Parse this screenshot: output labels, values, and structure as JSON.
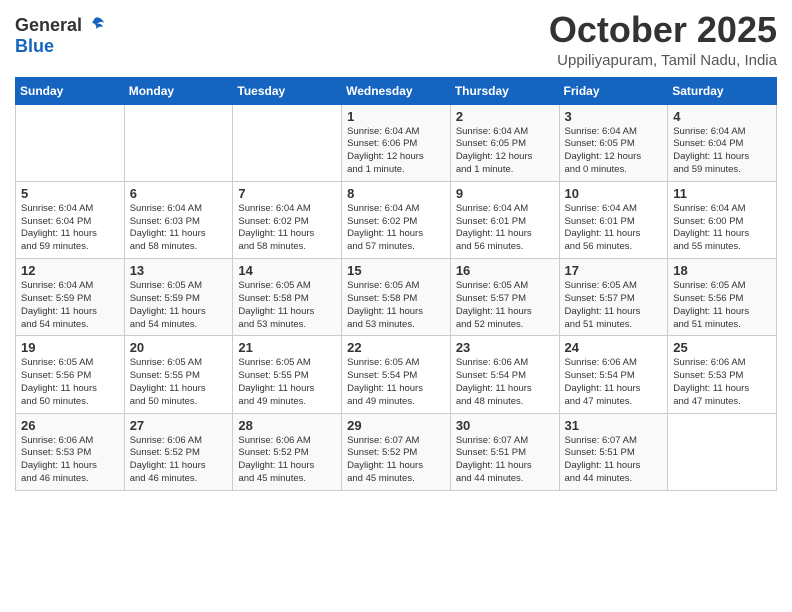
{
  "header": {
    "logo_general": "General",
    "logo_blue": "Blue",
    "month": "October 2025",
    "location": "Uppiliyapuram, Tamil Nadu, India"
  },
  "weekdays": [
    "Sunday",
    "Monday",
    "Tuesday",
    "Wednesday",
    "Thursday",
    "Friday",
    "Saturday"
  ],
  "weeks": [
    [
      {
        "day": "",
        "info": ""
      },
      {
        "day": "",
        "info": ""
      },
      {
        "day": "",
        "info": ""
      },
      {
        "day": "1",
        "info": "Sunrise: 6:04 AM\nSunset: 6:06 PM\nDaylight: 12 hours\nand 1 minute."
      },
      {
        "day": "2",
        "info": "Sunrise: 6:04 AM\nSunset: 6:05 PM\nDaylight: 12 hours\nand 1 minute."
      },
      {
        "day": "3",
        "info": "Sunrise: 6:04 AM\nSunset: 6:05 PM\nDaylight: 12 hours\nand 0 minutes."
      },
      {
        "day": "4",
        "info": "Sunrise: 6:04 AM\nSunset: 6:04 PM\nDaylight: 11 hours\nand 59 minutes."
      }
    ],
    [
      {
        "day": "5",
        "info": "Sunrise: 6:04 AM\nSunset: 6:04 PM\nDaylight: 11 hours\nand 59 minutes."
      },
      {
        "day": "6",
        "info": "Sunrise: 6:04 AM\nSunset: 6:03 PM\nDaylight: 11 hours\nand 58 minutes."
      },
      {
        "day": "7",
        "info": "Sunrise: 6:04 AM\nSunset: 6:02 PM\nDaylight: 11 hours\nand 58 minutes."
      },
      {
        "day": "8",
        "info": "Sunrise: 6:04 AM\nSunset: 6:02 PM\nDaylight: 11 hours\nand 57 minutes."
      },
      {
        "day": "9",
        "info": "Sunrise: 6:04 AM\nSunset: 6:01 PM\nDaylight: 11 hours\nand 56 minutes."
      },
      {
        "day": "10",
        "info": "Sunrise: 6:04 AM\nSunset: 6:01 PM\nDaylight: 11 hours\nand 56 minutes."
      },
      {
        "day": "11",
        "info": "Sunrise: 6:04 AM\nSunset: 6:00 PM\nDaylight: 11 hours\nand 55 minutes."
      }
    ],
    [
      {
        "day": "12",
        "info": "Sunrise: 6:04 AM\nSunset: 5:59 PM\nDaylight: 11 hours\nand 54 minutes."
      },
      {
        "day": "13",
        "info": "Sunrise: 6:05 AM\nSunset: 5:59 PM\nDaylight: 11 hours\nand 54 minutes."
      },
      {
        "day": "14",
        "info": "Sunrise: 6:05 AM\nSunset: 5:58 PM\nDaylight: 11 hours\nand 53 minutes."
      },
      {
        "day": "15",
        "info": "Sunrise: 6:05 AM\nSunset: 5:58 PM\nDaylight: 11 hours\nand 53 minutes."
      },
      {
        "day": "16",
        "info": "Sunrise: 6:05 AM\nSunset: 5:57 PM\nDaylight: 11 hours\nand 52 minutes."
      },
      {
        "day": "17",
        "info": "Sunrise: 6:05 AM\nSunset: 5:57 PM\nDaylight: 11 hours\nand 51 minutes."
      },
      {
        "day": "18",
        "info": "Sunrise: 6:05 AM\nSunset: 5:56 PM\nDaylight: 11 hours\nand 51 minutes."
      }
    ],
    [
      {
        "day": "19",
        "info": "Sunrise: 6:05 AM\nSunset: 5:56 PM\nDaylight: 11 hours\nand 50 minutes."
      },
      {
        "day": "20",
        "info": "Sunrise: 6:05 AM\nSunset: 5:55 PM\nDaylight: 11 hours\nand 50 minutes."
      },
      {
        "day": "21",
        "info": "Sunrise: 6:05 AM\nSunset: 5:55 PM\nDaylight: 11 hours\nand 49 minutes."
      },
      {
        "day": "22",
        "info": "Sunrise: 6:05 AM\nSunset: 5:54 PM\nDaylight: 11 hours\nand 49 minutes."
      },
      {
        "day": "23",
        "info": "Sunrise: 6:06 AM\nSunset: 5:54 PM\nDaylight: 11 hours\nand 48 minutes."
      },
      {
        "day": "24",
        "info": "Sunrise: 6:06 AM\nSunset: 5:54 PM\nDaylight: 11 hours\nand 47 minutes."
      },
      {
        "day": "25",
        "info": "Sunrise: 6:06 AM\nSunset: 5:53 PM\nDaylight: 11 hours\nand 47 minutes."
      }
    ],
    [
      {
        "day": "26",
        "info": "Sunrise: 6:06 AM\nSunset: 5:53 PM\nDaylight: 11 hours\nand 46 minutes."
      },
      {
        "day": "27",
        "info": "Sunrise: 6:06 AM\nSunset: 5:52 PM\nDaylight: 11 hours\nand 46 minutes."
      },
      {
        "day": "28",
        "info": "Sunrise: 6:06 AM\nSunset: 5:52 PM\nDaylight: 11 hours\nand 45 minutes."
      },
      {
        "day": "29",
        "info": "Sunrise: 6:07 AM\nSunset: 5:52 PM\nDaylight: 11 hours\nand 45 minutes."
      },
      {
        "day": "30",
        "info": "Sunrise: 6:07 AM\nSunset: 5:51 PM\nDaylight: 11 hours\nand 44 minutes."
      },
      {
        "day": "31",
        "info": "Sunrise: 6:07 AM\nSunset: 5:51 PM\nDaylight: 11 hours\nand 44 minutes."
      },
      {
        "day": "",
        "info": ""
      }
    ]
  ]
}
